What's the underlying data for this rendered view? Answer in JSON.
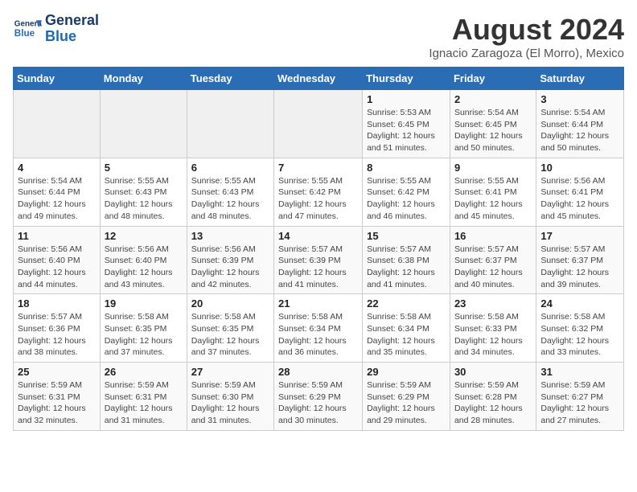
{
  "logo": {
    "line1": "General",
    "line2": "Blue"
  },
  "title": "August 2024",
  "subtitle": "Ignacio Zaragoza (El Morro), Mexico",
  "days_of_week": [
    "Sunday",
    "Monday",
    "Tuesday",
    "Wednesday",
    "Thursday",
    "Friday",
    "Saturday"
  ],
  "weeks": [
    [
      {
        "day": "",
        "detail": ""
      },
      {
        "day": "",
        "detail": ""
      },
      {
        "day": "",
        "detail": ""
      },
      {
        "day": "",
        "detail": ""
      },
      {
        "day": "1",
        "detail": "Sunrise: 5:53 AM\nSunset: 6:45 PM\nDaylight: 12 hours\nand 51 minutes."
      },
      {
        "day": "2",
        "detail": "Sunrise: 5:54 AM\nSunset: 6:45 PM\nDaylight: 12 hours\nand 50 minutes."
      },
      {
        "day": "3",
        "detail": "Sunrise: 5:54 AM\nSunset: 6:44 PM\nDaylight: 12 hours\nand 50 minutes."
      }
    ],
    [
      {
        "day": "4",
        "detail": "Sunrise: 5:54 AM\nSunset: 6:44 PM\nDaylight: 12 hours\nand 49 minutes."
      },
      {
        "day": "5",
        "detail": "Sunrise: 5:55 AM\nSunset: 6:43 PM\nDaylight: 12 hours\nand 48 minutes."
      },
      {
        "day": "6",
        "detail": "Sunrise: 5:55 AM\nSunset: 6:43 PM\nDaylight: 12 hours\nand 48 minutes."
      },
      {
        "day": "7",
        "detail": "Sunrise: 5:55 AM\nSunset: 6:42 PM\nDaylight: 12 hours\nand 47 minutes."
      },
      {
        "day": "8",
        "detail": "Sunrise: 5:55 AM\nSunset: 6:42 PM\nDaylight: 12 hours\nand 46 minutes."
      },
      {
        "day": "9",
        "detail": "Sunrise: 5:55 AM\nSunset: 6:41 PM\nDaylight: 12 hours\nand 45 minutes."
      },
      {
        "day": "10",
        "detail": "Sunrise: 5:56 AM\nSunset: 6:41 PM\nDaylight: 12 hours\nand 45 minutes."
      }
    ],
    [
      {
        "day": "11",
        "detail": "Sunrise: 5:56 AM\nSunset: 6:40 PM\nDaylight: 12 hours\nand 44 minutes."
      },
      {
        "day": "12",
        "detail": "Sunrise: 5:56 AM\nSunset: 6:40 PM\nDaylight: 12 hours\nand 43 minutes."
      },
      {
        "day": "13",
        "detail": "Sunrise: 5:56 AM\nSunset: 6:39 PM\nDaylight: 12 hours\nand 42 minutes."
      },
      {
        "day": "14",
        "detail": "Sunrise: 5:57 AM\nSunset: 6:39 PM\nDaylight: 12 hours\nand 41 minutes."
      },
      {
        "day": "15",
        "detail": "Sunrise: 5:57 AM\nSunset: 6:38 PM\nDaylight: 12 hours\nand 41 minutes."
      },
      {
        "day": "16",
        "detail": "Sunrise: 5:57 AM\nSunset: 6:37 PM\nDaylight: 12 hours\nand 40 minutes."
      },
      {
        "day": "17",
        "detail": "Sunrise: 5:57 AM\nSunset: 6:37 PM\nDaylight: 12 hours\nand 39 minutes."
      }
    ],
    [
      {
        "day": "18",
        "detail": "Sunrise: 5:57 AM\nSunset: 6:36 PM\nDaylight: 12 hours\nand 38 minutes."
      },
      {
        "day": "19",
        "detail": "Sunrise: 5:58 AM\nSunset: 6:35 PM\nDaylight: 12 hours\nand 37 minutes."
      },
      {
        "day": "20",
        "detail": "Sunrise: 5:58 AM\nSunset: 6:35 PM\nDaylight: 12 hours\nand 37 minutes."
      },
      {
        "day": "21",
        "detail": "Sunrise: 5:58 AM\nSunset: 6:34 PM\nDaylight: 12 hours\nand 36 minutes."
      },
      {
        "day": "22",
        "detail": "Sunrise: 5:58 AM\nSunset: 6:34 PM\nDaylight: 12 hours\nand 35 minutes."
      },
      {
        "day": "23",
        "detail": "Sunrise: 5:58 AM\nSunset: 6:33 PM\nDaylight: 12 hours\nand 34 minutes."
      },
      {
        "day": "24",
        "detail": "Sunrise: 5:58 AM\nSunset: 6:32 PM\nDaylight: 12 hours\nand 33 minutes."
      }
    ],
    [
      {
        "day": "25",
        "detail": "Sunrise: 5:59 AM\nSunset: 6:31 PM\nDaylight: 12 hours\nand 32 minutes."
      },
      {
        "day": "26",
        "detail": "Sunrise: 5:59 AM\nSunset: 6:31 PM\nDaylight: 12 hours\nand 31 minutes."
      },
      {
        "day": "27",
        "detail": "Sunrise: 5:59 AM\nSunset: 6:30 PM\nDaylight: 12 hours\nand 31 minutes."
      },
      {
        "day": "28",
        "detail": "Sunrise: 5:59 AM\nSunset: 6:29 PM\nDaylight: 12 hours\nand 30 minutes."
      },
      {
        "day": "29",
        "detail": "Sunrise: 5:59 AM\nSunset: 6:29 PM\nDaylight: 12 hours\nand 29 minutes."
      },
      {
        "day": "30",
        "detail": "Sunrise: 5:59 AM\nSunset: 6:28 PM\nDaylight: 12 hours\nand 28 minutes."
      },
      {
        "day": "31",
        "detail": "Sunrise: 5:59 AM\nSunset: 6:27 PM\nDaylight: 12 hours\nand 27 minutes."
      }
    ]
  ]
}
